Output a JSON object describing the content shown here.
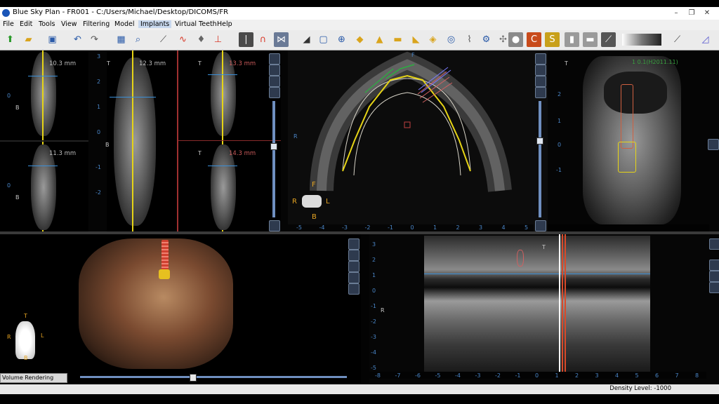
{
  "window": {
    "title": "Blue Sky Plan - FR001 - C:/Users/Michael/Desktop/DICOMS/FR",
    "minimize_glyph": "–",
    "restore_glyph": "❐",
    "close_glyph": "✕"
  },
  "menu": {
    "items": [
      "File",
      "Edit",
      "Tools",
      "View",
      "Filtering",
      "Model",
      "Implants",
      "Virtual Teeth",
      "Help"
    ],
    "selected": "Implants"
  },
  "toolbar": {
    "icons": [
      "new-file-icon",
      "open-folder-icon",
      "save-icon",
      "undo-icon",
      "redo-icon",
      "panorama-icon",
      "zoom-icon",
      "measure-icon",
      "nerve-icon",
      "tooth-icon",
      "implant-icon",
      "curve-icon",
      "draw-icon",
      "model-icon",
      "box-icon",
      "pick-icon",
      "tool-icon",
      "erase-icon",
      "ruler-icon",
      "sleeve-icon",
      "guide-icon",
      "crown-icon",
      "scan-icon",
      "camera-icon",
      "settings-icon",
      "mesh-icon",
      "skull-icon",
      "c-icon",
      "s-icon",
      "bone-icon",
      "bar-icon",
      "window-icon",
      "picker-icon",
      "chart-icon"
    ]
  },
  "cross_sections": {
    "measurements": [
      "10.3 mm",
      "12.3 mm",
      "13.3 mm",
      "11.3 mm",
      "14.3 mm"
    ],
    "orientation": {
      "top": "T",
      "bottom": "B"
    },
    "ruler_ticks": [
      "3",
      "2",
      "1",
      "0",
      "-1",
      "-2"
    ]
  },
  "axial": {
    "orientation": {
      "front": "F",
      "right": "R",
      "left": "L",
      "back": "B"
    },
    "ruler_ticks_x": [
      "-5",
      "-4",
      "-3",
      "-2",
      "-1",
      "0",
      "1",
      "2",
      "3",
      "4",
      "5"
    ]
  },
  "implant_view": {
    "label": "1 0.1(H2011.11)",
    "ruler_ticks": [
      "2",
      "1",
      "0",
      "-1"
    ]
  },
  "volume": {
    "mode": "Volume Rendering",
    "orientation": {
      "top": "T",
      "right": "R",
      "left": "L",
      "bottom": "B"
    }
  },
  "panoramic": {
    "orientation": {
      "right": "R",
      "top": "T"
    },
    "ruler_ticks_y": [
      "3",
      "2",
      "1",
      "0",
      "-1",
      "-2",
      "-3",
      "-4",
      "-5"
    ],
    "ruler_ticks_x": [
      "-8",
      "-7",
      "-6",
      "-5",
      "-4",
      "-3",
      "-2",
      "-1",
      "0",
      "1",
      "2",
      "3",
      "4",
      "5",
      "6",
      "7",
      "8"
    ]
  },
  "status": {
    "density_level": "Density Level: -1000"
  },
  "colors": {
    "accent_yellow": "#e6d416",
    "guide_blue": "#3a8fd8",
    "toolbar_bg": "#ebebeb"
  }
}
